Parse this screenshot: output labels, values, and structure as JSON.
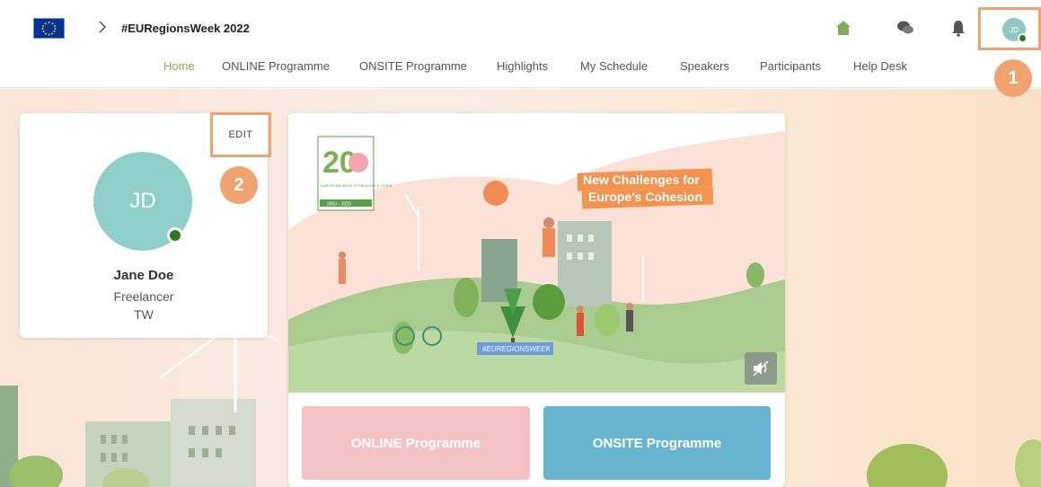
{
  "header": {
    "breadcrumb_title": "#EURegionsWeek 2022",
    "avatar_initials": "JD",
    "icons": [
      "eu-flag-icon",
      "chevron-right-icon",
      "home-icon",
      "chat-icon",
      "bell-icon"
    ]
  },
  "nav": {
    "items": [
      {
        "label": "Home",
        "active": true
      },
      {
        "label": "ONLINE Programme"
      },
      {
        "label": "ONSITE Programme"
      },
      {
        "label": "Highlights"
      },
      {
        "label": "My Schedule"
      },
      {
        "label": "Speakers"
      },
      {
        "label": "Participants"
      },
      {
        "label": "Help Desk"
      }
    ]
  },
  "annotations": {
    "badge_1": "1",
    "badge_2": "2"
  },
  "profile": {
    "edit_label": "EDIT",
    "initials": "JD",
    "name": "Jane Doe",
    "role": "Freelancer",
    "country": "TW"
  },
  "banner": {
    "logo_number": "20",
    "logo_caption": "EUROPEAN WEEK OF REGIONS & CITIES",
    "logo_years": "2003 - 2023",
    "headline_line1": "New Challenges for",
    "headline_line2": "Europe's Cohesion",
    "hashtag": "#EUREGIONSWEEK"
  },
  "buttons": {
    "online": "ONLINE Programme",
    "onsite": "ONSITE Programme"
  },
  "colors": {
    "accent_orange": "#f0a36e",
    "nav_active": "#7fae56",
    "online_button": "#f3c2c2",
    "onsite_button": "#68b5d0",
    "status_online": "#2f7a1f",
    "avatar": "#8ed0c7"
  }
}
